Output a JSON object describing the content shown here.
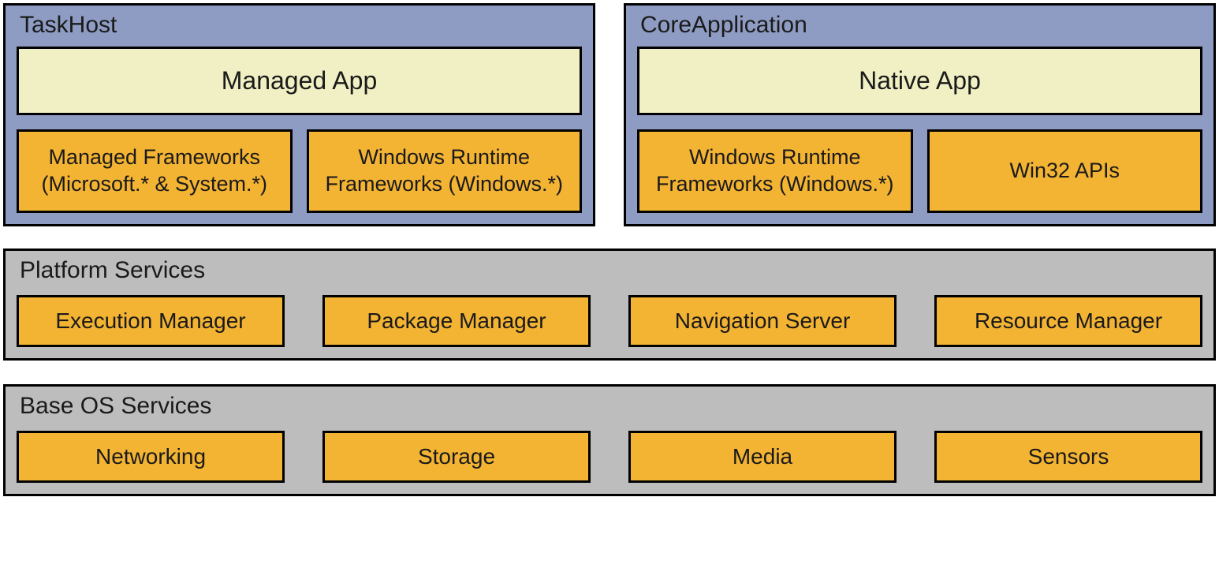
{
  "taskhost": {
    "title": "TaskHost",
    "app": "Managed App",
    "frameworks": [
      "Managed Frameworks (Microsoft.* & System.*)",
      "Windows Runtime Frameworks (Windows.*)"
    ]
  },
  "coreapp": {
    "title": "CoreApplication",
    "app": "Native App",
    "frameworks": [
      "Windows Runtime Frameworks (Windows.*)",
      "Win32 APIs"
    ]
  },
  "platform": {
    "title": "Platform Services",
    "items": [
      "Execution Manager",
      "Package Manager",
      "Navigation Server",
      "Resource Manager"
    ]
  },
  "baseos": {
    "title": "Base OS Services",
    "items": [
      "Networking",
      "Storage",
      "Media",
      "Sensors"
    ]
  }
}
